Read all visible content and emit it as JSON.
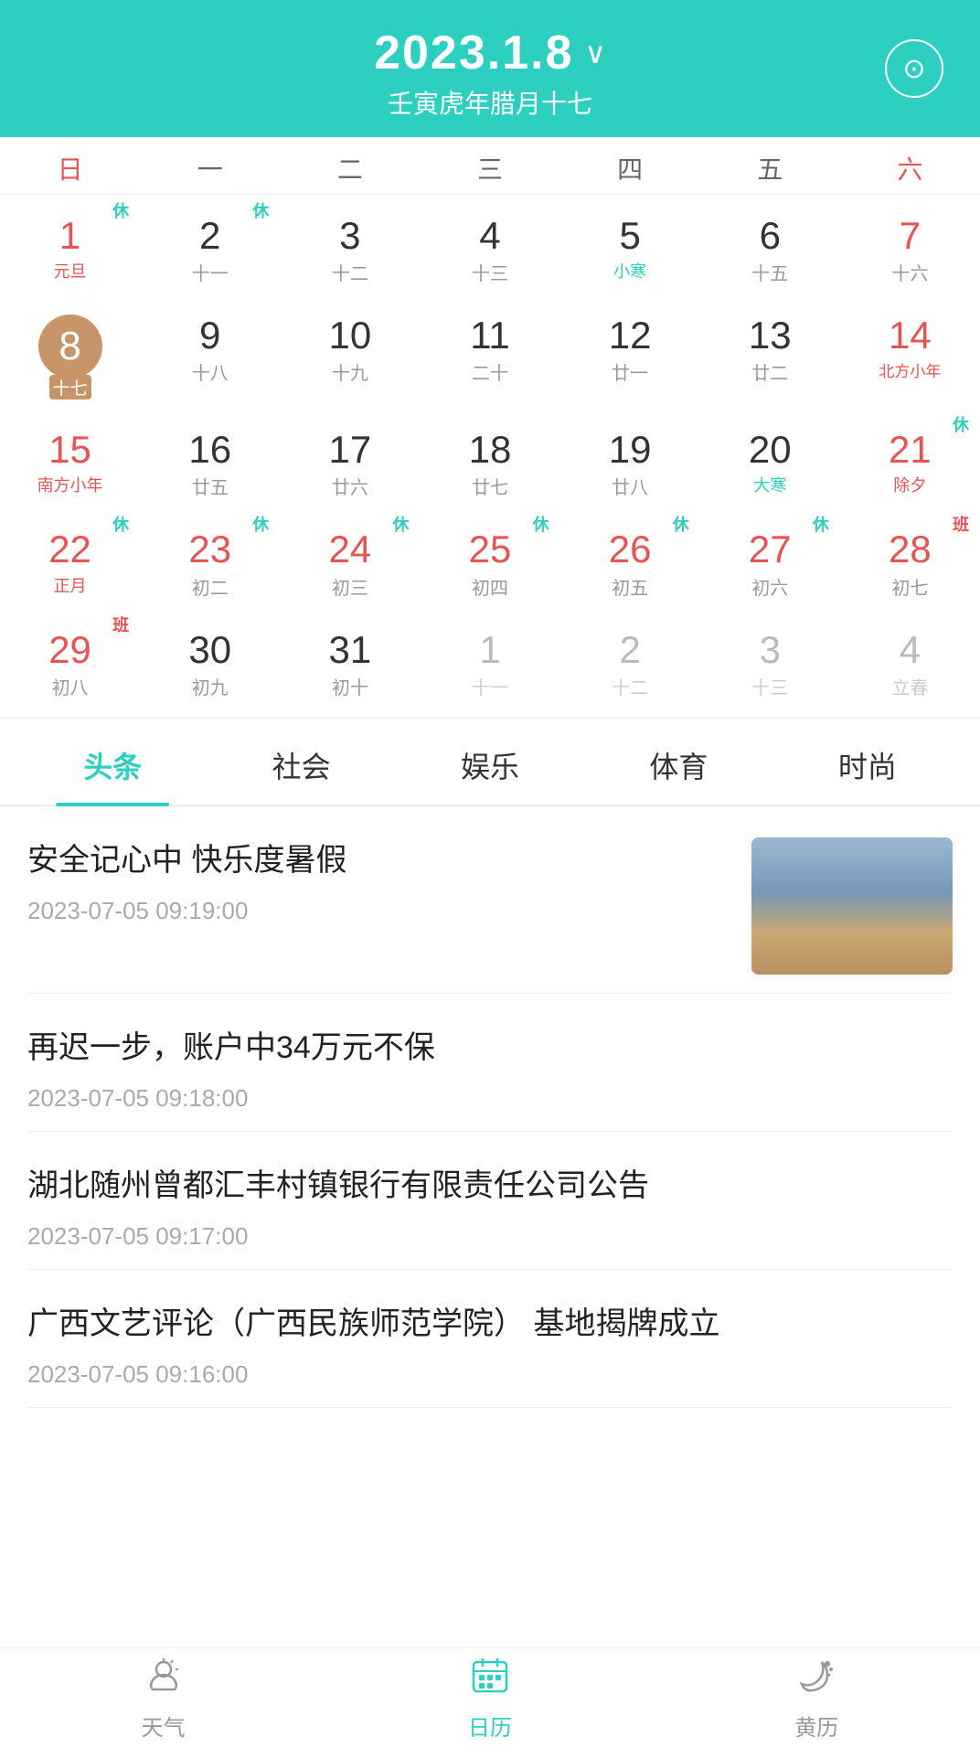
{
  "header": {
    "date": "2023.1.8",
    "chevron": "∨",
    "lunar": "壬寅虎年腊月十七",
    "today_icon": "⊙"
  },
  "weekdays": [
    "日",
    "一",
    "二",
    "三",
    "四",
    "五",
    "六"
  ],
  "calendar": {
    "weeks": [
      [
        {
          "num": "1",
          "lunar": "元旦",
          "badge": "休",
          "badge_type": "xiu",
          "type": "holiday",
          "is_sun": true
        },
        {
          "num": "2",
          "lunar": "十一",
          "badge": "休",
          "badge_type": "xiu",
          "type": "normal"
        },
        {
          "num": "3",
          "lunar": "十二",
          "badge": "",
          "badge_type": "",
          "type": "normal"
        },
        {
          "num": "4",
          "lunar": "十三",
          "badge": "",
          "badge_type": "",
          "type": "normal"
        },
        {
          "num": "5",
          "lunar": "小寒",
          "badge": "",
          "badge_type": "",
          "type": "solar",
          "sub_type": "solar-term"
        },
        {
          "num": "6",
          "lunar": "十五",
          "badge": "",
          "badge_type": "",
          "type": "normal"
        },
        {
          "num": "7",
          "lunar": "十六",
          "badge": "",
          "badge_type": "",
          "type": "normal",
          "is_sat": true
        }
      ],
      [
        {
          "num": "8",
          "lunar": "十七",
          "badge": "",
          "badge_type": "",
          "type": "today",
          "is_sun": true
        },
        {
          "num": "9",
          "lunar": "十八",
          "badge": "",
          "badge_type": "",
          "type": "normal"
        },
        {
          "num": "10",
          "lunar": "十九",
          "badge": "",
          "badge_type": "",
          "type": "normal"
        },
        {
          "num": "11",
          "lunar": "二十",
          "badge": "",
          "badge_type": "",
          "type": "normal"
        },
        {
          "num": "12",
          "lunar": "廿一",
          "badge": "",
          "badge_type": "",
          "type": "normal"
        },
        {
          "num": "13",
          "lunar": "廿二",
          "badge": "",
          "badge_type": "",
          "type": "normal"
        },
        {
          "num": "14",
          "lunar": "北方小年",
          "badge": "",
          "badge_type": "",
          "type": "festival",
          "is_sat": true
        }
      ],
      [
        {
          "num": "15",
          "lunar": "南方小年",
          "badge": "",
          "badge_type": "",
          "type": "holiday",
          "is_sun": true
        },
        {
          "num": "16",
          "lunar": "廿五",
          "badge": "",
          "badge_type": "",
          "type": "normal"
        },
        {
          "num": "17",
          "lunar": "廿六",
          "badge": "",
          "badge_type": "",
          "type": "normal"
        },
        {
          "num": "18",
          "lunar": "廿七",
          "badge": "",
          "badge_type": "",
          "type": "normal"
        },
        {
          "num": "19",
          "lunar": "廿八",
          "badge": "",
          "badge_type": "",
          "type": "normal"
        },
        {
          "num": "20",
          "lunar": "大寒",
          "badge": "",
          "badge_type": "",
          "type": "solar",
          "sub_type": "solar-term"
        },
        {
          "num": "21",
          "lunar": "除夕",
          "badge": "休",
          "badge_type": "xiu",
          "type": "holiday",
          "is_sat": true
        }
      ],
      [
        {
          "num": "22",
          "lunar": "正月",
          "badge": "休",
          "badge_type": "xiu",
          "type": "holiday",
          "is_sun": true
        },
        {
          "num": "23",
          "lunar": "初二",
          "badge": "休",
          "badge_type": "xiu",
          "type": "holiday"
        },
        {
          "num": "24",
          "lunar": "初三",
          "badge": "休",
          "badge_type": "xiu",
          "type": "holiday"
        },
        {
          "num": "25",
          "lunar": "初四",
          "badge": "休",
          "badge_type": "xiu",
          "type": "holiday"
        },
        {
          "num": "26",
          "lunar": "初五",
          "badge": "休",
          "badge_type": "xiu",
          "type": "holiday"
        },
        {
          "num": "27",
          "lunar": "初六",
          "badge": "休",
          "badge_type": "xiu",
          "type": "holiday"
        },
        {
          "num": "28",
          "lunar": "初七",
          "badge": "班",
          "badge_type": "ban",
          "type": "normal",
          "is_sat": true
        }
      ],
      [
        {
          "num": "29",
          "lunar": "初八",
          "badge": "班",
          "badge_type": "ban",
          "type": "holiday",
          "is_sun": true
        },
        {
          "num": "30",
          "lunar": "初九",
          "badge": "",
          "badge_type": "",
          "type": "normal"
        },
        {
          "num": "31",
          "lunar": "初十",
          "badge": "",
          "badge_type": "",
          "type": "normal"
        },
        {
          "num": "1",
          "lunar": "十一",
          "badge": "",
          "badge_type": "",
          "type": "gray"
        },
        {
          "num": "2",
          "lunar": "十二",
          "badge": "",
          "badge_type": "",
          "type": "gray"
        },
        {
          "num": "3",
          "lunar": "十三",
          "badge": "",
          "badge_type": "",
          "type": "gray"
        },
        {
          "num": "4",
          "lunar": "立春",
          "badge": "",
          "badge_type": "",
          "type": "gray-solar",
          "is_sat": true
        }
      ]
    ]
  },
  "tabs": {
    "items": [
      "头条",
      "社会",
      "娱乐",
      "体育",
      "时尚"
    ],
    "active": 0
  },
  "news": [
    {
      "title": "安全记心中  快乐度暑假",
      "time": "2023-07-05  09:19:00",
      "has_thumb": true
    },
    {
      "title": "再迟一步，账户中34万元不保",
      "time": "2023-07-05  09:18:00",
      "has_thumb": false
    },
    {
      "title": "湖北随州曾都汇丰村镇银行有限责任公司公告",
      "time": "2023-07-05  09:17:00",
      "has_thumb": false
    },
    {
      "title": "广西文艺评论（广西民族师范学院）  基地揭牌成立",
      "time": "2023-07-05  09:16:00",
      "has_thumb": false
    }
  ],
  "bottom_nav": {
    "items": [
      {
        "label": "天气",
        "icon": "weather",
        "active": false
      },
      {
        "label": "日历",
        "icon": "calendar",
        "active": true
      },
      {
        "label": "黄历",
        "icon": "moon",
        "active": false
      }
    ]
  }
}
